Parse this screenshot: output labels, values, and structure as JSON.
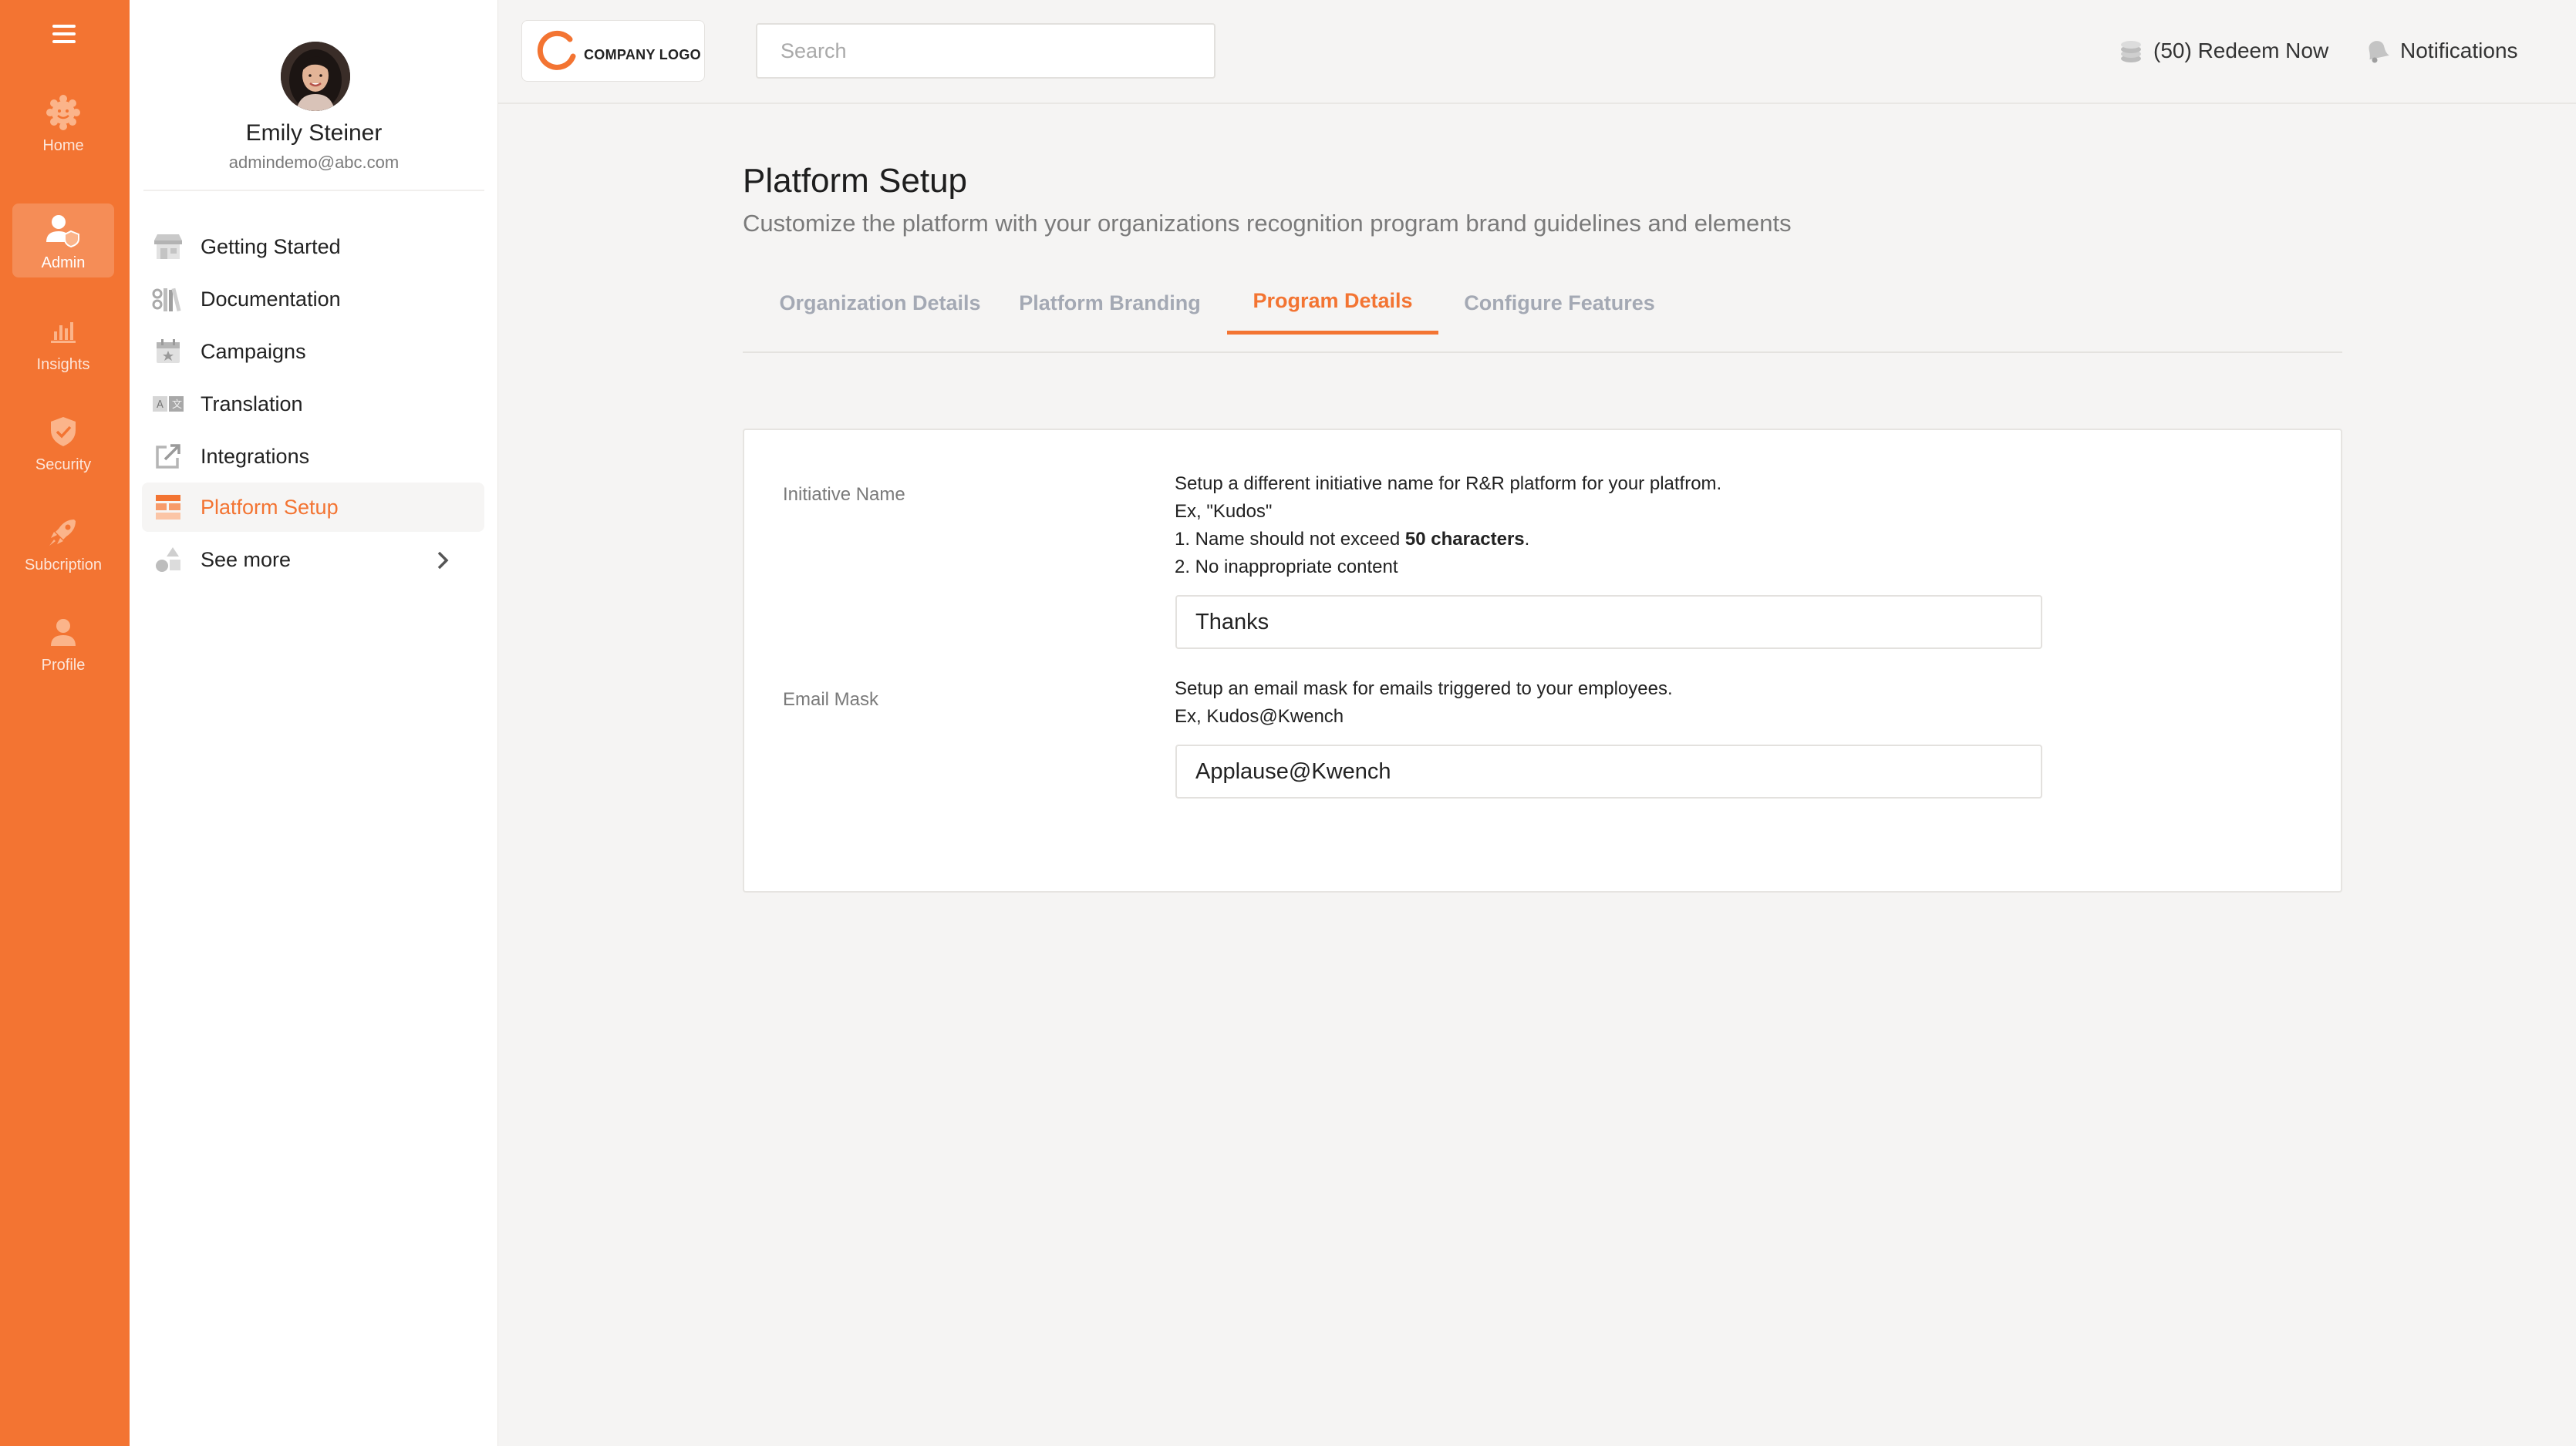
{
  "rail": {
    "items": [
      {
        "label": "Home",
        "icon": "home-icon"
      },
      {
        "label": "Admin",
        "icon": "admin-icon",
        "active": true
      },
      {
        "label": "Insights",
        "icon": "insights-icon"
      },
      {
        "label": "Security",
        "icon": "security-icon"
      },
      {
        "label": "Subcription",
        "icon": "rocket-icon"
      },
      {
        "label": "Profile",
        "icon": "profile-icon"
      }
    ]
  },
  "user": {
    "name": "Emily Steiner",
    "email": "admindemo@abc.com"
  },
  "sidebar": {
    "items": [
      {
        "label": "Getting Started",
        "icon": "store-icon"
      },
      {
        "label": "Documentation",
        "icon": "books-icon"
      },
      {
        "label": "Campaigns",
        "icon": "calendar-star-icon"
      },
      {
        "label": "Translation",
        "icon": "translate-icon"
      },
      {
        "label": "Integrations",
        "icon": "external-link-icon"
      },
      {
        "label": "Platform Setup",
        "icon": "layout-icon",
        "active": true
      },
      {
        "label": "See more",
        "icon": "shapes-icon"
      }
    ]
  },
  "header": {
    "logo_text": "COMPANY LOGO",
    "search_placeholder": "Search",
    "redeem_label": "(50) Redeem Now",
    "notifications_label": "Notifications"
  },
  "main": {
    "title": "Platform Setup",
    "subtitle": "Customize the platform with your organizations recognition program brand guidelines and elements",
    "tabs": [
      {
        "label": "Organization Details"
      },
      {
        "label": "Platform Branding"
      },
      {
        "label": "Program Details",
        "active": true
      },
      {
        "label": "Configure Features"
      }
    ]
  },
  "form": {
    "initiative": {
      "label": "Initiative Name",
      "help_line1": "Setup a different initiative name for R&R platform for your platfrom.",
      "help_line2": "Ex, \"Kudos\"",
      "help_line3_prefix": "1. Name should not exceed ",
      "help_line3_bold": "50 characters",
      "help_line3_suffix": ".",
      "help_line4": "2. No inappropriate content",
      "value": "Thanks"
    },
    "email_mask": {
      "label": "Email Mask",
      "help_line1": "Setup an email mask for emails triggered to your employees.",
      "help_line2": "Ex, Kudos@Kwench",
      "value": "Applause@Kwench"
    }
  },
  "colors": {
    "accent": "#f37432",
    "tab_inactive": "#a4a9b4",
    "background": "#f5f4f3"
  }
}
